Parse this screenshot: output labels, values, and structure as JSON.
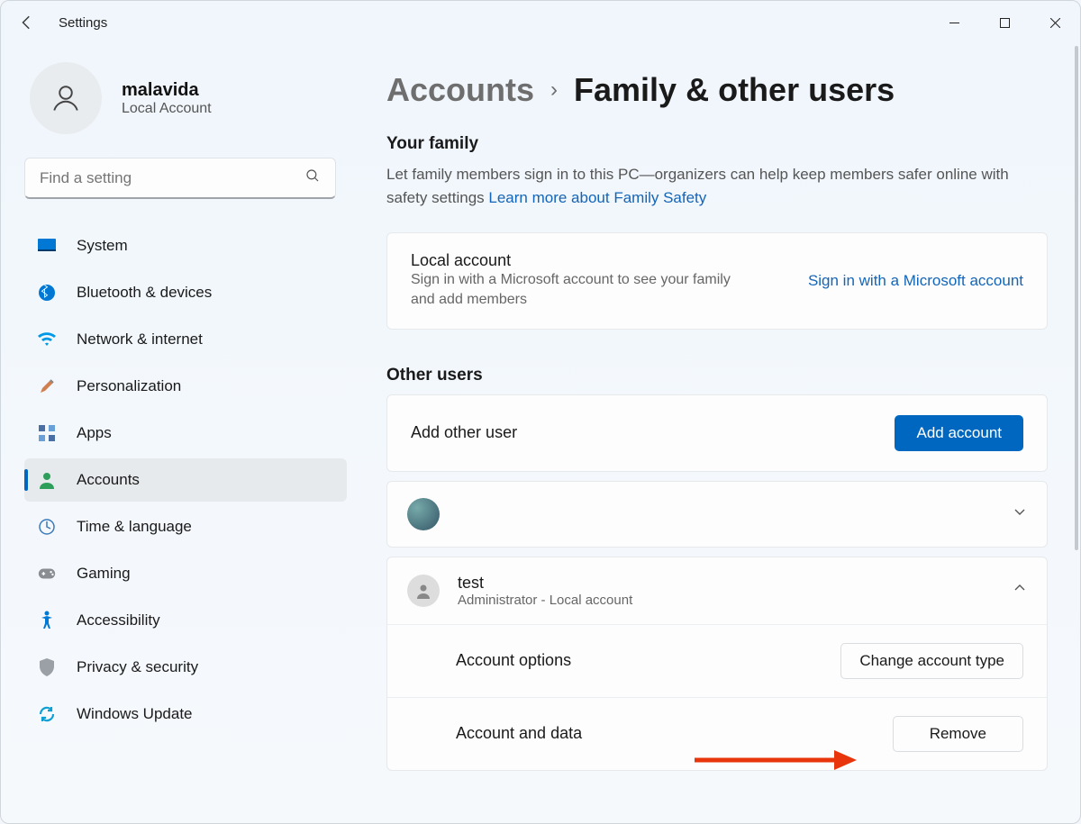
{
  "window": {
    "title": "Settings"
  },
  "profile": {
    "name": "malavida",
    "subtitle": "Local Account"
  },
  "search": {
    "placeholder": "Find a setting"
  },
  "sidebar": {
    "items": [
      {
        "label": "System"
      },
      {
        "label": "Bluetooth & devices"
      },
      {
        "label": "Network & internet"
      },
      {
        "label": "Personalization"
      },
      {
        "label": "Apps"
      },
      {
        "label": "Accounts"
      },
      {
        "label": "Time & language"
      },
      {
        "label": "Gaming"
      },
      {
        "label": "Accessibility"
      },
      {
        "label": "Privacy & security"
      },
      {
        "label": "Windows Update"
      }
    ]
  },
  "breadcrumb": {
    "root": "Accounts",
    "current": "Family & other users"
  },
  "family": {
    "title": "Your family",
    "desc": "Let family members sign in to this PC—organizers can help keep members safer online with safety settings  ",
    "link": "Learn more about Family Safety",
    "card_title": "Local account",
    "card_sub": "Sign in with a Microsoft account to see your family and add members",
    "card_action": "Sign in with a Microsoft account"
  },
  "other": {
    "title": "Other users",
    "add_label": "Add other user",
    "add_button": "Add account",
    "users": [
      {
        "name": "",
        "sub": ""
      },
      {
        "name": "test",
        "sub": "Administrator - Local account"
      }
    ],
    "options": {
      "account_options": "Account options",
      "change_type": "Change account type",
      "account_data": "Account and data",
      "remove": "Remove"
    }
  }
}
